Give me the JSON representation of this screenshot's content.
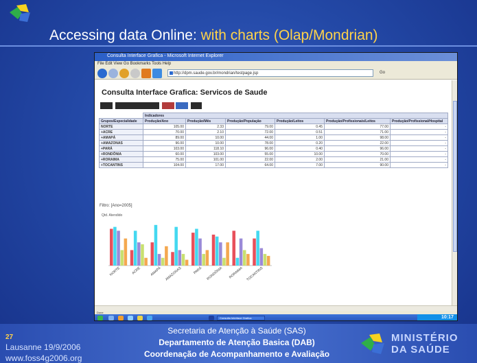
{
  "slide": {
    "title_prefix": "Accessing data Online: ",
    "title_highlight": "with charts (Olap/Mondrian)"
  },
  "browser": {
    "titlebar": "Consulta Interface Grafica - Microsoft Internet Explorer",
    "menu": "File  Edit  View  Go  Bookmarks  Tools  Help",
    "address": "http://dpm.saude.gov.br/mondrian/testpage.jsp",
    "toolbar_right": "Go",
    "page_title": "Consulta Interface Grafica: Servicos de Saude",
    "filter_label": "Filtro: [Ano=2005]",
    "chart_label": "Qtd. Atendido",
    "status": "Done",
    "taskbar_window": "Consulta Interface Grafica",
    "clock": "10:17"
  },
  "table": {
    "group_header": "Indicadores",
    "columns": [
      "Grupos/Especialidade",
      "Produção/Ano",
      "Produção/Mês",
      "Produção/População",
      "Produção/Leitos",
      "Produção/Profissionais/Leitos",
      "Produção/Profissional/Hospital"
    ],
    "rows": [
      {
        "label": "NORTE",
        "cells": [
          "105.00",
          "2.33",
          "79.00",
          "0.45",
          "77.00",
          "-"
        ]
      },
      {
        "label": "+ACRE",
        "cells": [
          "70.00",
          "2.10",
          "72.00",
          "0.51",
          "71.00",
          "-"
        ]
      },
      {
        "label": "+AMAPÁ",
        "cells": [
          "89.00",
          "10.00",
          "44.00",
          "1.00",
          "98.00",
          "-"
        ]
      },
      {
        "label": "+AMAZONAS",
        "cells": [
          "96.00",
          "10.00",
          "78.00",
          "0.20",
          "22.00",
          "-"
        ]
      },
      {
        "label": "+PARÁ",
        "cells": [
          "103.00",
          "118.10",
          "96.00",
          "0.40",
          "96.00",
          "-"
        ]
      },
      {
        "label": "+RONDÔNIA",
        "cells": [
          "60.00",
          "103.00",
          "55.00",
          "10.00",
          "70.00",
          "-"
        ]
      },
      {
        "label": "+RORAIMA",
        "cells": [
          "75.00",
          "101.00",
          "22.00",
          "2.00",
          "21.00",
          "-"
        ]
      },
      {
        "label": "+TOCANTINS",
        "cells": [
          "104.00",
          "17.00",
          "64.00",
          "7.00",
          "90.00",
          "-"
        ]
      }
    ]
  },
  "chart_data": {
    "type": "bar",
    "title": "Qtd. Atendido",
    "categories": [
      "NORTE",
      "ACRE",
      "AMAPÁ",
      "AMAZONAS",
      "PARÁ",
      "RONDÔNIA",
      "RORAIMA",
      "TOCANTINS"
    ],
    "series": [
      {
        "color": "#e8505b",
        "values": [
          95,
          40,
          60,
          35,
          85,
          80,
          90,
          70
        ]
      },
      {
        "color": "#44d8f0",
        "values": [
          100,
          90,
          105,
          100,
          95,
          75,
          20,
          90
        ]
      },
      {
        "color": "#9a8ad8",
        "values": [
          90,
          60,
          30,
          40,
          70,
          60,
          70,
          45
        ]
      },
      {
        "color": "#c8e070",
        "values": [
          40,
          55,
          20,
          30,
          30,
          20,
          40,
          30
        ]
      },
      {
        "color": "#f4a850",
        "values": [
          70,
          20,
          50,
          15,
          40,
          60,
          30,
          25
        ]
      }
    ],
    "ylim": [
      0,
      110
    ]
  },
  "footer": {
    "slide_number": "27",
    "place_date": "Lausanne 19/9/2006",
    "website": "www.foss4g2006.org",
    "line1": "Secretaria de Atenção à Saúde (SAS)",
    "line2": "Departamento de Atenção Basica (DAB)",
    "line3": "Coordenação de Acompanhamento e Avaliação",
    "ministry_line1": "MINISTÉRIO",
    "ministry_line2": "DA SAÚDE"
  },
  "colors": {
    "title_highlight": "#ffd34a",
    "slide_background": "#244aa8"
  }
}
